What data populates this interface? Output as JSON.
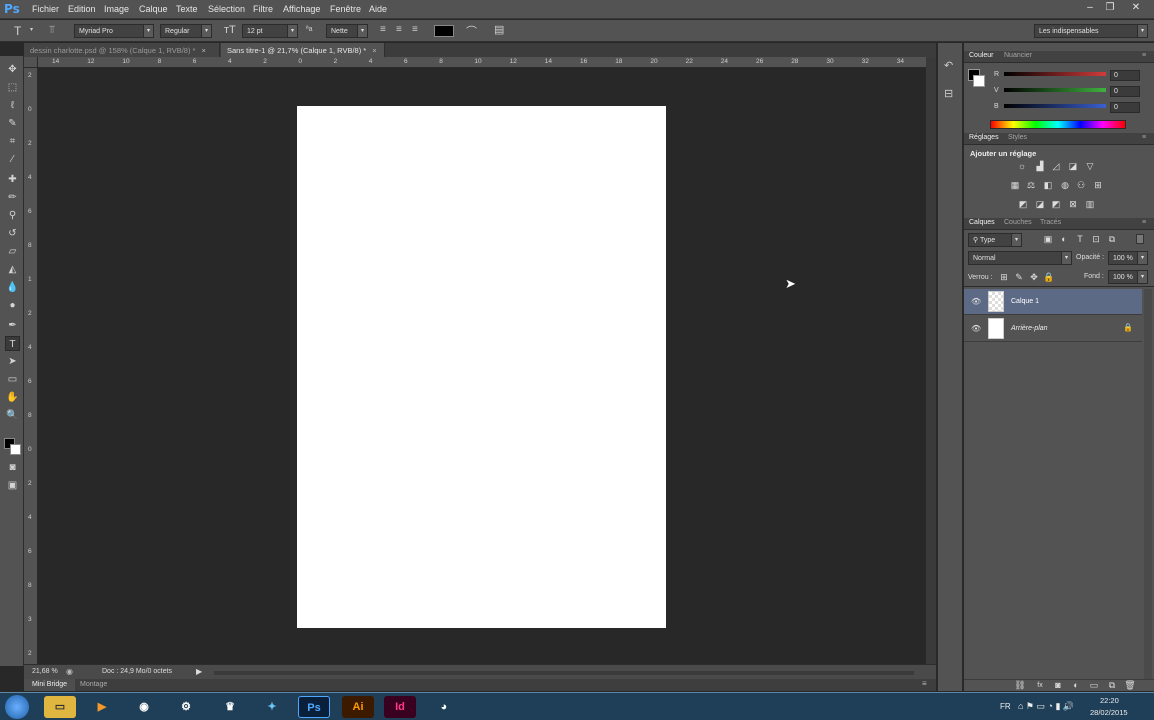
{
  "app": {
    "logo": "Ps"
  },
  "menu": {
    "items": [
      "Fichier",
      "Edition",
      "Image",
      "Calque",
      "Texte",
      "Sélection",
      "Filtre",
      "Affichage",
      "Fenêtre",
      "Aide"
    ]
  },
  "options": {
    "font_family": "Myriad Pro",
    "font_style": "Regular",
    "font_size": "12 pt",
    "aa_prefix": "ªa",
    "antialias": "Nette",
    "workspace": "Les indispensables",
    "text_color": "#000000"
  },
  "tabs": [
    {
      "label": "dessin charlotte.psd @ 158% (Calque 1, RVB/8) *",
      "close": "×"
    },
    {
      "label": "Sans titre-1 @ 21,7% (Calque 1, RVB/8) *",
      "close": "×"
    }
  ],
  "ruler_h": [
    "14",
    "12",
    "10",
    "8",
    "6",
    "4",
    "2",
    "0",
    "2",
    "4",
    "6",
    "8",
    "10",
    "12",
    "14",
    "16",
    "18",
    "20",
    "22",
    "24",
    "26",
    "28",
    "30",
    "32",
    "34"
  ],
  "ruler_v": [
    "2",
    "0",
    "2",
    "4",
    "6",
    "8",
    "1",
    "2",
    "4",
    "6",
    "8",
    "0",
    "2",
    "4",
    "6",
    "8",
    "3",
    "2"
  ],
  "status": {
    "zoom": "21,68 %",
    "doc_info": "Doc : 24,9 Mo/0 octets"
  },
  "bottom_tabs": [
    "Mini Bridge",
    "Montage"
  ],
  "color_panel": {
    "tabs": [
      "Couleur",
      "Nuancier"
    ],
    "channels": [
      {
        "label": "R",
        "value": "0",
        "color": "#d23b3b"
      },
      {
        "label": "V",
        "value": "0",
        "color": "#3fb23f"
      },
      {
        "label": "B",
        "value": "0",
        "color": "#3a5fd0"
      }
    ]
  },
  "adjust_panel": {
    "tabs": [
      "Réglages",
      "Styles"
    ],
    "heading": "Ajouter un réglage"
  },
  "layers_panel": {
    "tabs": [
      "Calques",
      "Couches",
      "Tracés"
    ],
    "filter": "Type",
    "blend_mode": "Normal",
    "opacity_label": "Opacité :",
    "opacity": "100 %",
    "lock_label": "Verrou :",
    "fill_label": "Fond :",
    "fill": "100 %",
    "layers": [
      {
        "name": "Calque 1",
        "selected": true
      },
      {
        "name": "Arrière-plan",
        "selected": false
      }
    ]
  },
  "taskbar": {
    "lang": "FR",
    "time": "22:20",
    "date": "28/02/2015",
    "apps": [
      "Ps",
      "Ai",
      "Id"
    ]
  }
}
